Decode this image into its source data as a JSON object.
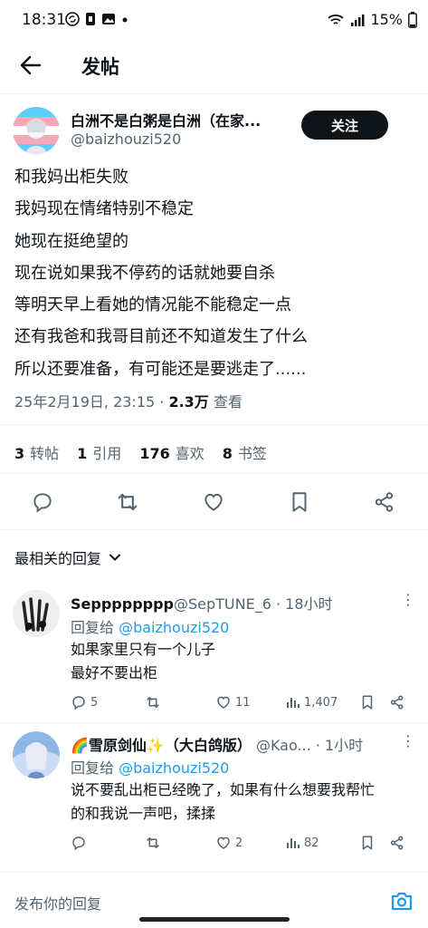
{
  "status": {
    "time": "18:31",
    "battery": "15%"
  },
  "header": {
    "title": "发帖"
  },
  "post": {
    "author_name": "白洲不是白粥是白洲（在家...",
    "author_handle": "@baizhouzi520",
    "follow_label": "关注",
    "lines": [
      "和我妈出柜失败",
      "我妈现在情绪特别不稳定",
      "她现在挺绝望的",
      "现在说如果我不停药的话就她要自杀",
      "等明天早上看她的情况能不能稳定一点",
      "还有我爸和我哥目前还不知道发生了什么",
      "所以还要准备，有可能还是要逃走了......"
    ],
    "date": "25年2月19日, 23:15 · ",
    "views": "2.3万",
    "views_label": " 查看",
    "stats": {
      "reposts": "3",
      "reposts_label": "转帖",
      "quotes": "1",
      "quotes_label": "引用",
      "likes": "176",
      "likes_label": "喜欢",
      "bookmarks": "8",
      "bookmarks_label": "书签"
    }
  },
  "sort_label": "最相关的回复",
  "replies": [
    {
      "name": "Sepppppppp",
      "handle": "@SepTUNE_6 · 18小时",
      "reply_to_prefix": "回复给 ",
      "reply_to": "@baizhouzi520",
      "lines": [
        "如果家里只有一个儿子",
        "最好不要出柜"
      ],
      "comments": "5",
      "retweets": "",
      "likes": "11",
      "views": "1,407"
    },
    {
      "name": "🌈雪原剑仙✨（大白鸽版）",
      "handle": " @Kao... · 1小时",
      "reply_to_prefix": "回复给 ",
      "reply_to": "@baizhouzi520",
      "lines": [
        "说不要乱出柜已经晚了，如果有什么想要我帮忙",
        "的和我说一声吧，揉揉"
      ],
      "comments": "",
      "retweets": "",
      "likes": "2",
      "views": "82"
    }
  ],
  "composer": {
    "placeholder": "发布你的回复"
  },
  "colors": {
    "accent": "#1d9bf0",
    "text": "#0f1419",
    "muted": "#536471"
  }
}
